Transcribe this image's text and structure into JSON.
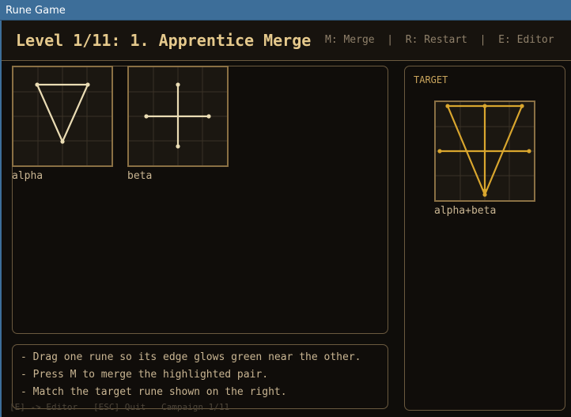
{
  "window": {
    "title": "Rune Game"
  },
  "header": {
    "level_title": "Level 1/11: 1. Apprentice Merge",
    "hints": "M: Merge  |  R: Restart  |  E: Editor"
  },
  "workspace": {
    "runes": [
      {
        "label": "alpha",
        "icon": "triangle-rune-icon"
      },
      {
        "label": "beta",
        "icon": "cross-rune-icon"
      }
    ]
  },
  "target": {
    "heading": "TARGET",
    "rune_label": "alpha+beta",
    "icon": "merged-rune-icon"
  },
  "instructions": [
    "- Drag one rune so its edge glows green near the other.",
    "- Press M to merge the highlighted pair.",
    "- Match the target rune shown on the right."
  ],
  "footer": "[E] -> Editor   [ESC] Quit   Campaign 1/11",
  "colors": {
    "accent": "#e5c98c",
    "rune_stroke": "#eadcb4",
    "target_stroke": "#d9a62e",
    "tile_border": "#8a7044",
    "panel_border": "#6b5a3f",
    "titlebar": "#3d6e99"
  }
}
